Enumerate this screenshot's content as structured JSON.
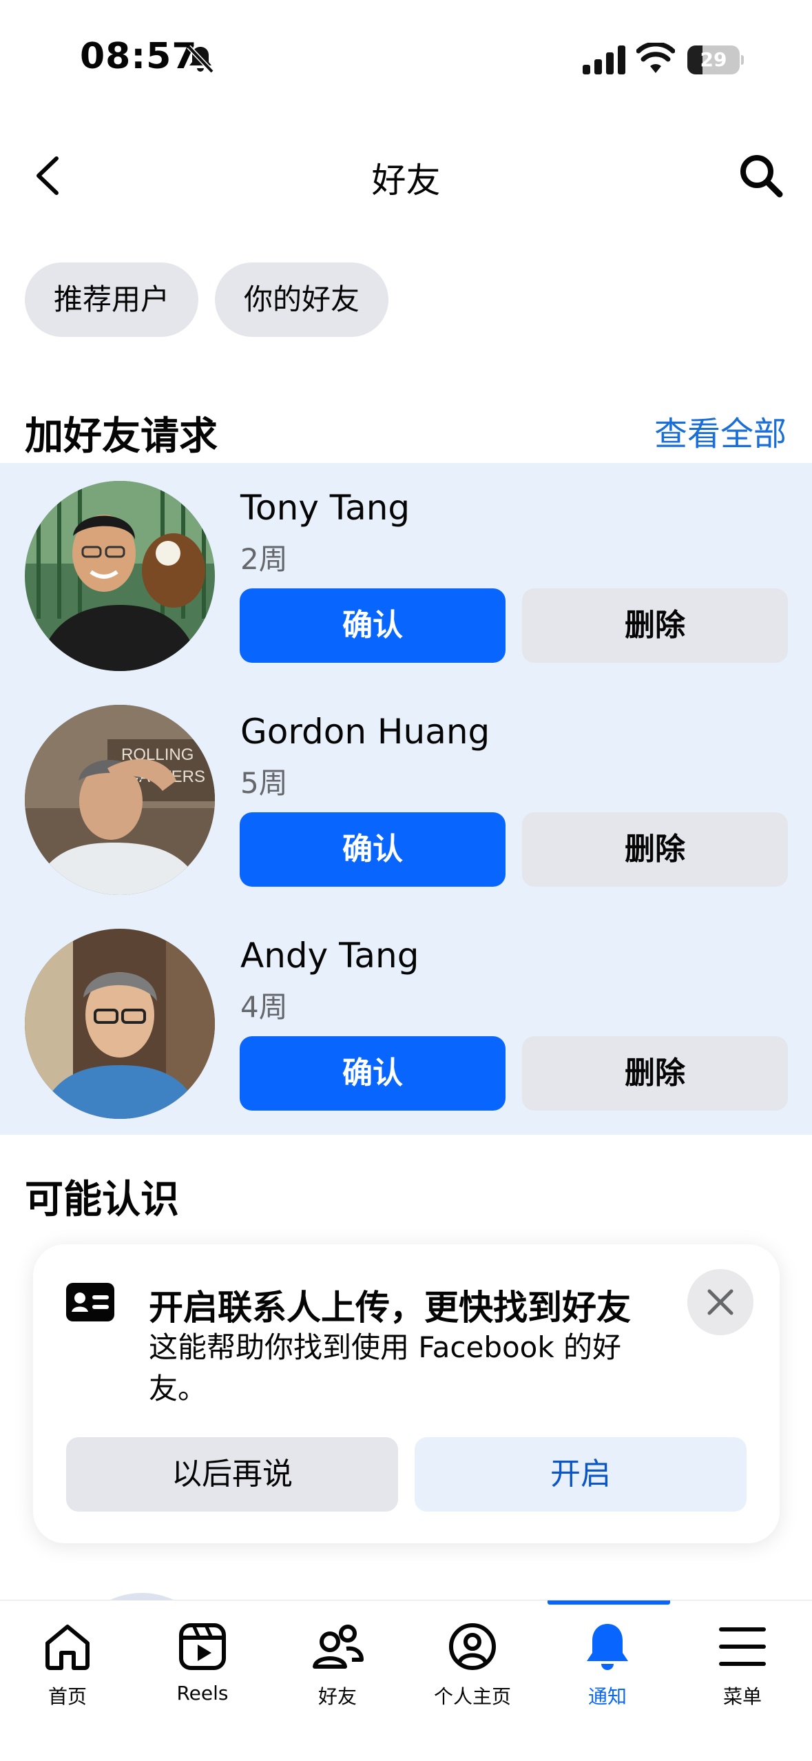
{
  "status_bar": {
    "time": "08:57",
    "battery": "29",
    "battery_level": 0.29
  },
  "header": {
    "title": "好友"
  },
  "filters": {
    "suggestions": "推荐用户",
    "your_friends": "你的好友"
  },
  "requests": {
    "title": "加好友请求",
    "see_all": "查看全部",
    "confirm_label": "确认",
    "delete_label": "删除",
    "items": [
      {
        "name": "Tony Tang",
        "time": "2周"
      },
      {
        "name": "Gordon Huang",
        "time": "5周"
      },
      {
        "name": "Andy Tang",
        "time": "4周"
      }
    ]
  },
  "people_you_may_know": {
    "title": "可能认识"
  },
  "contact_card": {
    "title": "开启联系人上传，更快找到好友",
    "body": "这能帮助你找到使用 Facebook 的好友。",
    "later": "以后再说",
    "enable": "开启"
  },
  "tabbar": {
    "items": [
      {
        "label": "首页",
        "icon": "home-icon"
      },
      {
        "label": "Reels",
        "icon": "reels-icon"
      },
      {
        "label": "好友",
        "icon": "friends-icon"
      },
      {
        "label": "个人主页",
        "icon": "profile-icon"
      },
      {
        "label": "通知",
        "icon": "bell-icon",
        "active": true
      },
      {
        "label": "菜单",
        "icon": "menu-icon"
      }
    ]
  },
  "colors": {
    "accent": "#0866ff",
    "request_bg": "#e7f0fb",
    "chip_bg": "#e4e6eb"
  }
}
